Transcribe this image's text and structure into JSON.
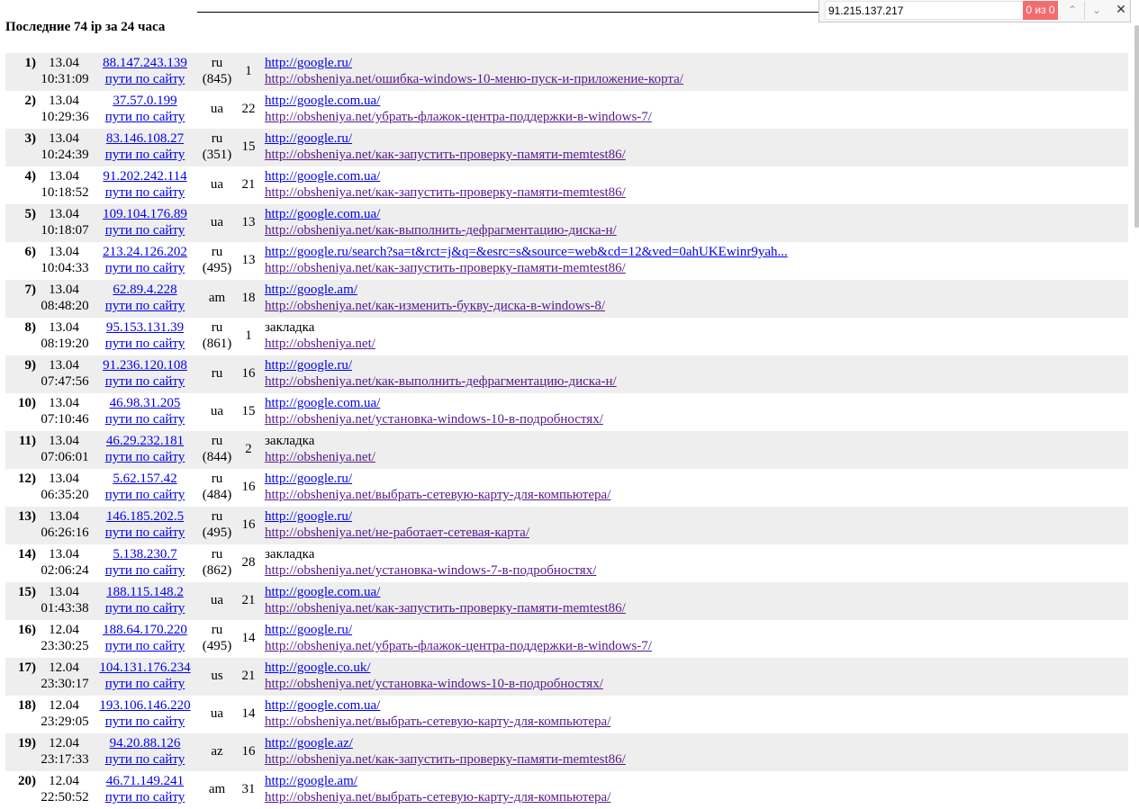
{
  "heading": "Последние 74 ip за 24 часа",
  "findbar": {
    "query": "91.215.137.217",
    "count": "0 из 0"
  },
  "rows": [
    {
      "num": "1)",
      "date": "13.04",
      "time": "10:31:09",
      "ip": "88.147.243.139",
      "paths": "пути по сайту",
      "cc": "ru",
      "tel": "(845)",
      "cnt": "1",
      "ref": "http://google.ru/",
      "page": "http://obsheniya.net/ошибка-windows-10-меню-пуск-и-приложение-корта/"
    },
    {
      "num": "2)",
      "date": "13.04",
      "time": "10:29:36",
      "ip": "37.57.0.199",
      "paths": "пути по сайту",
      "cc": "ua",
      "tel": "",
      "cnt": "22",
      "ref": "http://google.com.ua/",
      "page": "http://obsheniya.net/убрать-флажок-центра-поддержки-в-windows-7/"
    },
    {
      "num": "3)",
      "date": "13.04",
      "time": "10:24:39",
      "ip": "83.146.108.27",
      "paths": "пути по сайту",
      "cc": "ru",
      "tel": "(351)",
      "cnt": "15",
      "ref": "http://google.ru/",
      "page": "http://obsheniya.net/как-запустить-проверку-памяти-memtest86/"
    },
    {
      "num": "4)",
      "date": "13.04",
      "time": "10:18:52",
      "ip": "91.202.242.114",
      "paths": "пути по сайту",
      "cc": "ua",
      "tel": "",
      "cnt": "21",
      "ref": "http://google.com.ua/",
      "page": "http://obsheniya.net/как-запустить-проверку-памяти-memtest86/"
    },
    {
      "num": "5)",
      "date": "13.04",
      "time": "10:18:07",
      "ip": "109.104.176.89",
      "paths": "пути по сайту",
      "cc": "ua",
      "tel": "",
      "cnt": "13",
      "ref": "http://google.com.ua/",
      "page": "http://obsheniya.net/как-выполнить-дефрагментацию-диска-н/"
    },
    {
      "num": "6)",
      "date": "13.04",
      "time": "10:04:33",
      "ip": "213.24.126.202",
      "paths": "пути по сайту",
      "cc": "ru",
      "tel": "(495)",
      "cnt": "13",
      "ref": "http://google.ru/search?sa=t&rct=j&q=&esrc=s&source=web&cd=12&ved=0ahUKEwinr9yah...",
      "page": "http://obsheniya.net/как-запустить-проверку-памяти-memtest86/"
    },
    {
      "num": "7)",
      "date": "13.04",
      "time": "08:48:20",
      "ip": "62.89.4.228",
      "paths": "пути по сайту",
      "cc": "am",
      "tel": "",
      "cnt": "18",
      "ref": "http://google.am/",
      "page": "http://obsheniya.net/как-изменить-букву-диска-в-windows-8/"
    },
    {
      "num": "8)",
      "date": "13.04",
      "time": "08:19:20",
      "ip": "95.153.131.39",
      "paths": "пути по сайту",
      "cc": "ru",
      "tel": "(861)",
      "cnt": "1",
      "ref": "закладка",
      "page": "http://obsheniya.net/"
    },
    {
      "num": "9)",
      "date": "13.04",
      "time": "07:47:56",
      "ip": "91.236.120.108",
      "paths": "пути по сайту",
      "cc": "ru",
      "tel": "",
      "cnt": "16",
      "ref": "http://google.ru/",
      "page": "http://obsheniya.net/как-выполнить-дефрагментацию-диска-н/"
    },
    {
      "num": "10)",
      "date": "13.04",
      "time": "07:10:46",
      "ip": "46.98.31.205",
      "paths": "пути по сайту",
      "cc": "ua",
      "tel": "",
      "cnt": "15",
      "ref": "http://google.com.ua/",
      "page": "http://obsheniya.net/установка-windows-10-в-подробностях/"
    },
    {
      "num": "11)",
      "date": "13.04",
      "time": "07:06:01",
      "ip": "46.29.232.181",
      "paths": "пути по сайту",
      "cc": "ru",
      "tel": "(844)",
      "cnt": "2",
      "ref": "закладка",
      "page": "http://obsheniya.net/"
    },
    {
      "num": "12)",
      "date": "13.04",
      "time": "06:35:20",
      "ip": "5.62.157.42",
      "paths": "пути по сайту",
      "cc": "ru",
      "tel": "(484)",
      "cnt": "16",
      "ref": "http://google.ru/",
      "page": "http://obsheniya.net/выбрать-сетевую-карту-для-компьютера/"
    },
    {
      "num": "13)",
      "date": "13.04",
      "time": "06:26:16",
      "ip": "146.185.202.5",
      "paths": "пути по сайту",
      "cc": "ru",
      "tel": "(495)",
      "cnt": "16",
      "ref": "http://google.ru/",
      "page": "http://obsheniya.net/не-работает-сетевая-карта/"
    },
    {
      "num": "14)",
      "date": "13.04",
      "time": "02:06:24",
      "ip": "5.138.230.7",
      "paths": "пути по сайту",
      "cc": "ru",
      "tel": "(862)",
      "cnt": "28",
      "ref": "закладка",
      "page": "http://obsheniya.net/установка-windows-7-в-подробностях/"
    },
    {
      "num": "15)",
      "date": "13.04",
      "time": "01:43:38",
      "ip": "188.115.148.2",
      "paths": "пути по сайту",
      "cc": "ua",
      "tel": "",
      "cnt": "21",
      "ref": "http://google.com.ua/",
      "page": "http://obsheniya.net/как-запустить-проверку-памяти-memtest86/"
    },
    {
      "num": "16)",
      "date": "12.04",
      "time": "23:30:25",
      "ip": "188.64.170.220",
      "paths": "пути по сайту",
      "cc": "ru",
      "tel": "(495)",
      "cnt": "14",
      "ref": "http://google.ru/",
      "page": "http://obsheniya.net/убрать-флажок-центра-поддержки-в-windows-7/"
    },
    {
      "num": "17)",
      "date": "12.04",
      "time": "23:30:17",
      "ip": "104.131.176.234",
      "paths": "пути по сайту",
      "cc": "us",
      "tel": "",
      "cnt": "21",
      "ref": "http://google.co.uk/",
      "page": "http://obsheniya.net/установка-windows-10-в-подробностях/"
    },
    {
      "num": "18)",
      "date": "12.04",
      "time": "23:29:05",
      "ip": "193.106.146.220",
      "paths": "пути по сайту",
      "cc": "ua",
      "tel": "",
      "cnt": "14",
      "ref": "http://google.com.ua/",
      "page": "http://obsheniya.net/выбрать-сетевую-карту-для-компьютера/"
    },
    {
      "num": "19)",
      "date": "12.04",
      "time": "23:17:33",
      "ip": "94.20.88.126",
      "paths": "пути по сайту",
      "cc": "az",
      "tel": "",
      "cnt": "16",
      "ref": "http://google.az/",
      "page": "http://obsheniya.net/как-запустить-проверку-памяти-memtest86/"
    },
    {
      "num": "20)",
      "date": "12.04",
      "time": "22:50:52",
      "ip": "46.71.149.241",
      "paths": "пути по сайту",
      "cc": "am",
      "tel": "",
      "cnt": "31",
      "ref": "http://google.am/",
      "page": "http://obsheniya.net/выбрать-сетевую-карту-для-компьютера/"
    }
  ]
}
